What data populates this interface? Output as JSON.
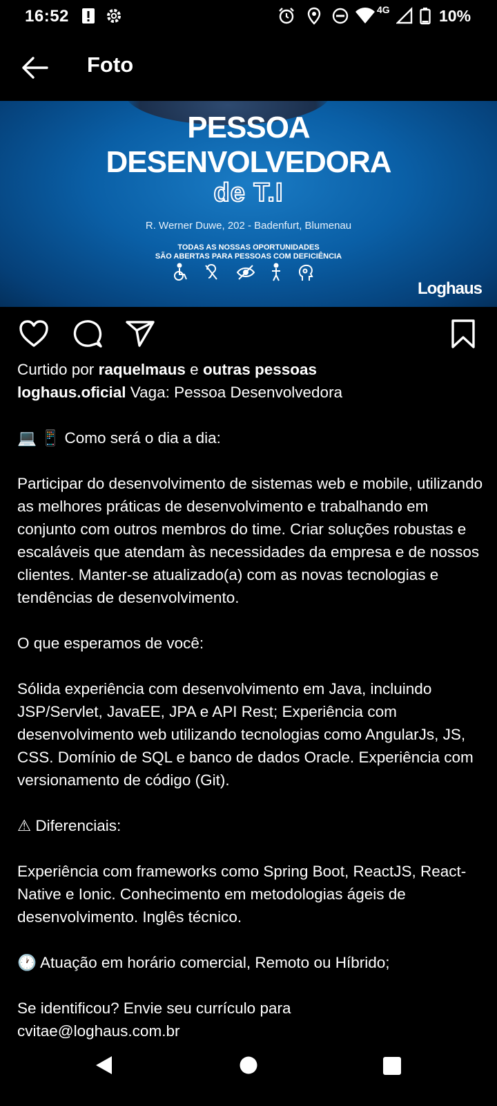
{
  "status_bar": {
    "time": "16:52",
    "network": "4G",
    "battery": "10%",
    "icons": [
      "alert-icon",
      "settings-icon",
      "alarm-icon",
      "location-icon",
      "dnd-icon",
      "wifi-icon",
      "signal-icon",
      "battery-icon"
    ]
  },
  "header": {
    "title": "Foto",
    "back_icon": "arrow-left-icon"
  },
  "post_image": {
    "line1": "PESSOA",
    "line2": "DESENVOLVEDORA",
    "line3": "de T.I",
    "address": "R. Werner Duwe, 202 - Badenfurt, Blumenau",
    "note_line1": "TODAS AS NOSSAS OPORTUNIDADES",
    "note_line2": "SÃO ABERTAS PARA PESSOAS COM DEFICIÊNCIA",
    "brand": "Loghaus",
    "accessibility_icons": [
      "wheelchair-icon",
      "hearing-icon",
      "visual-icon",
      "person-icon",
      "cognitive-icon"
    ]
  },
  "actions": {
    "like": "heart-icon",
    "comment": "comment-icon",
    "share": "send-icon",
    "save": "bookmark-icon"
  },
  "likes": {
    "prefix": "Curtido por",
    "user": "raquelmaus",
    "connector": "e",
    "others": "outras pessoas"
  },
  "caption": {
    "username": "loghaus.oficial",
    "headline": "Vaga: Pessoa Desenvolvedora",
    "day_heading": "💻 📱 Como será o dia a dia:",
    "day_text": "Participar do desenvolvimento de sistemas web e mobile, utilizando as melhores práticas de desenvolvimento e trabalhando em conjunto com outros membros do time. Criar soluções robustas e escaláveis que atendam às necessidades da empresa e de nossos clientes. Manter-se atualizado(a) com as novas tecnologias e tendências de desenvolvimento.",
    "expect_heading": "O que esperamos de você:",
    "expect_text": "Sólida experiência com desenvolvimento em Java, incluindo JSP/Servlet, JavaEE, JPA e API Rest; Experiência com desenvolvimento web utilizando tecnologias como AngularJs, JS, CSS. Domínio de SQL e banco de dados Oracle. Experiência com versionamento de código (Git).",
    "diff_heading": "⚠ Diferenciais:",
    "diff_text": "Experiência com frameworks como Spring Boot, ReactJS, React-Native e Ionic. Conhecimento em metodologias ágeis de desenvolvimento. Inglês técnico.",
    "schedule": "🕐 Atuação em horário comercial, Remoto ou Híbrido;",
    "cta_line1": "Se identificou? Envie seu currículo para",
    "cta_line2": "cvitae@loghaus.com.br"
  },
  "nav_bar": {
    "back": "back-triangle-icon",
    "home": "home-circle-icon",
    "recents": "recents-square-icon"
  }
}
